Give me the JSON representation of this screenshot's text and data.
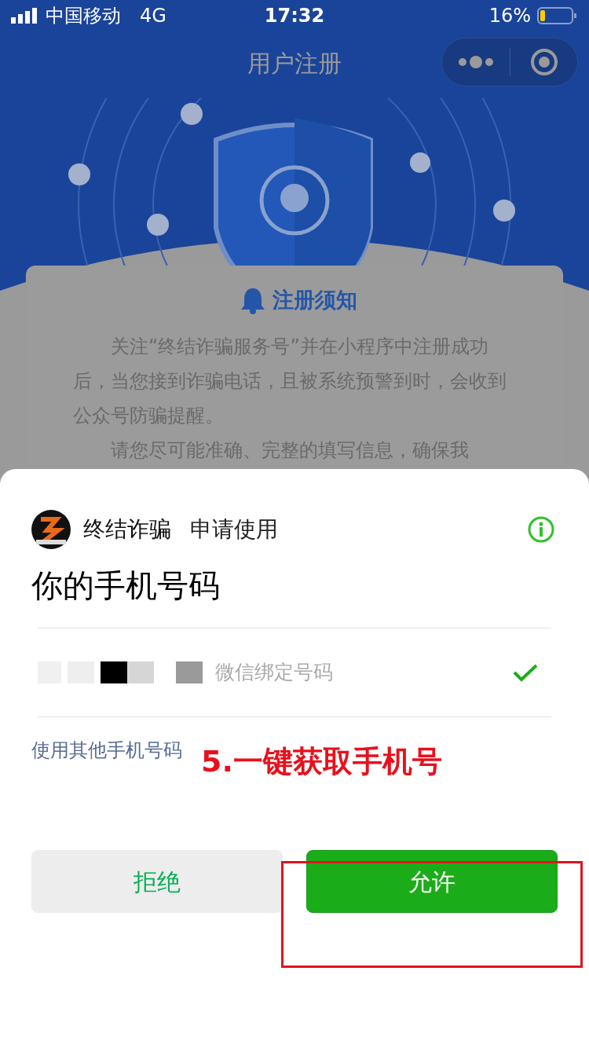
{
  "status_bar": {
    "carrier": "中国移动",
    "network": "4G",
    "time": "17:32",
    "battery": "16%"
  },
  "nav": {
    "title": "用户注册"
  },
  "notice": {
    "title": "注册须知",
    "paragraphs": [
      "关注“终结诈骗服务号”并在小程序中注册成功后，当您接到诈骗电话，且被系统预警到时，会收到公众号防骗提醒。",
      "请您尽可能准确、完整的填写信息，确保我"
    ]
  },
  "sheet": {
    "app_name": "终结诈骗",
    "request": "申请使用",
    "heading": "你的手机号码",
    "phones": [
      {
        "hint": "微信绑定号码",
        "selected": true
      }
    ],
    "other_link": "使用其他手机号码",
    "buttons": [
      {
        "label": "拒绝",
        "kind": "secondary"
      },
      {
        "label": "允许",
        "kind": "primary"
      }
    ]
  },
  "annotation": {
    "text": "5.一键获取手机号"
  }
}
